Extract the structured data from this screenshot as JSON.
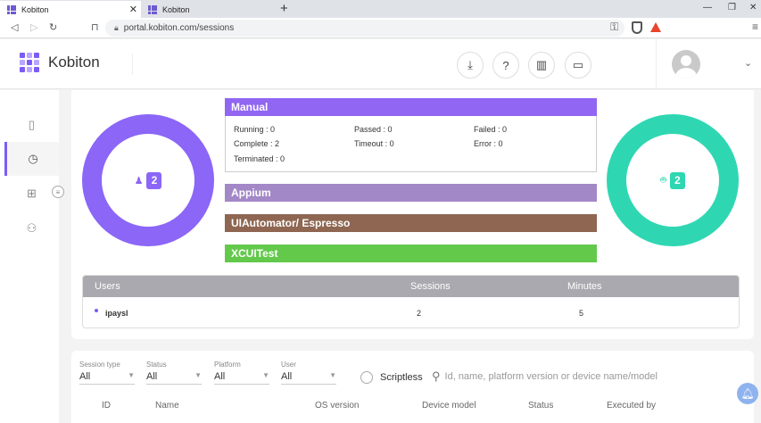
{
  "browser": {
    "tabs": [
      {
        "title": "Kobiton",
        "active": true
      },
      {
        "title": "Kobiton",
        "active": false
      }
    ],
    "url": "portal.kobiton.com/sessions"
  },
  "header": {
    "brand": "Kobiton",
    "icons": [
      "download-icon",
      "help-icon",
      "map-icon",
      "device-card-icon"
    ]
  },
  "sidebar": {
    "items": [
      "device-icon",
      "clock-icon",
      "apps-grid-icon",
      "users-icon"
    ]
  },
  "summary": {
    "ios_count": "2",
    "android_count": "2",
    "colors": {
      "ios": "#8b66f7",
      "android": "#2ed7b2",
      "manual": "#9166f2",
      "appium": "#a388c8",
      "uiautomator": "#8e6651",
      "xcuitest": "#63c94b"
    },
    "manual": {
      "title": "Manual",
      "running": "Running : 0",
      "passed": "Passed : 0",
      "failed": "Failed : 0",
      "complete": "Complete : 2",
      "timeout": "Timeout : 0",
      "error": "Error : 0",
      "terminated": "Terminated : 0"
    },
    "appium": "Appium",
    "uiautomator": "UIAutomator/ Espresso",
    "xcuitest": "XCUITest"
  },
  "users_table": {
    "headers": [
      "Users",
      "Sessions",
      "Minutes"
    ],
    "rows": [
      {
        "user": "ipaysl",
        "sessions": "2",
        "minutes": "5"
      }
    ]
  },
  "filters": {
    "session_type": {
      "label": "Session type",
      "value": "All"
    },
    "status": {
      "label": "Status",
      "value": "All"
    },
    "platform": {
      "label": "Platform",
      "value": "All"
    },
    "user": {
      "label": "User",
      "value": "All"
    },
    "scriptless": "Scriptless",
    "search_placeholder": "Id, name, platform version or device name/model"
  },
  "sessions_table": {
    "columns": [
      "ID",
      "Name",
      "OS version",
      "Device model",
      "Status",
      "Executed by"
    ]
  }
}
